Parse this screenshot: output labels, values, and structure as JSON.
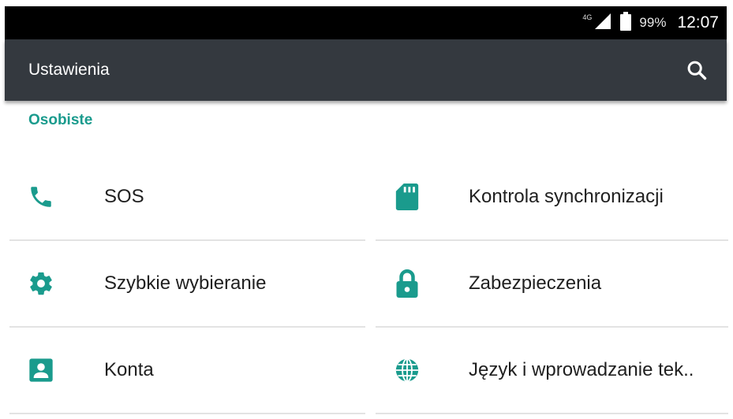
{
  "status_bar": {
    "network": "4G",
    "battery": "99%",
    "time": "12:07"
  },
  "toolbar": {
    "title": "Ustawienia",
    "search_icon": "search-icon"
  },
  "section": {
    "title": "Osobiste"
  },
  "colors": {
    "accent": "#1a9b8d",
    "toolbar_bg": "#34393f",
    "status_bar_bg": "#000000"
  },
  "items": [
    {
      "label": "SOS",
      "icon": "phone-icon"
    },
    {
      "label": "Kontrola synchronizacji",
      "icon": "sd-card-icon"
    },
    {
      "label": "Szybkie wybieranie",
      "icon": "gear-icon"
    },
    {
      "label": "Zabezpieczenia",
      "icon": "lock-icon"
    },
    {
      "label": "Konta",
      "icon": "account-icon"
    },
    {
      "label": "Język i wprowadzanie tek..",
      "icon": "globe-icon"
    }
  ]
}
